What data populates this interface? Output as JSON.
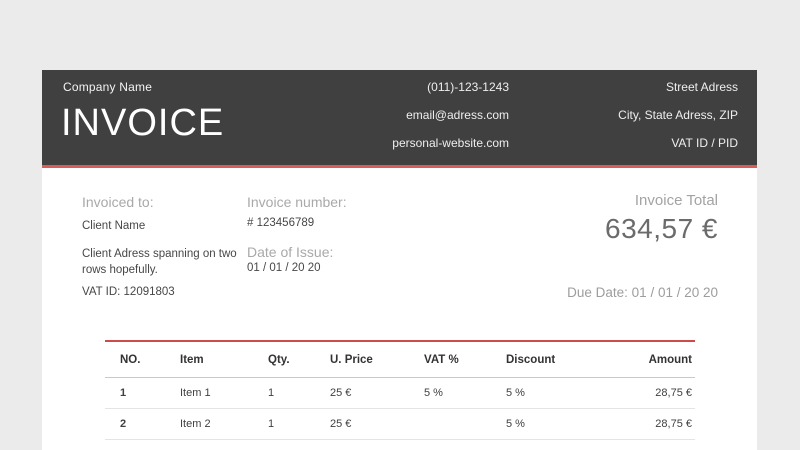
{
  "colors": {
    "canvas_background": "#ebebeb",
    "header_background": "#404040",
    "accent_red_header": "#d95c5c",
    "accent_red_table": "#cc4b4b"
  },
  "header": {
    "company_name": "Company Name",
    "doc_title": "INVOICE",
    "contact": {
      "phone": "(011)-123-1243",
      "email": "email@adress.com",
      "website": "personal-website.com"
    },
    "address": {
      "street": "Street Adress",
      "city": "City, State Adress, ZIP",
      "vat": "VAT ID / PID"
    }
  },
  "billing": {
    "label": "Invoiced to:",
    "client_name": "Client Name",
    "client_address_line1": "Client Adress spanning on two",
    "client_address_line2": "rows hopefully.",
    "vat_id": "VAT ID: 12091803"
  },
  "meta": {
    "invoice_number_label": "Invoice number:",
    "invoice_number": "# 123456789",
    "date_of_issue_label": "Date of Issue:",
    "date_of_issue": "01 / 01 / 20 20"
  },
  "totals": {
    "total_label": "Invoice Total",
    "total_value": "634,57 €",
    "due_date": "Due Date: 01 / 01 / 20 20"
  },
  "table": {
    "columns": [
      "NO.",
      "Item",
      "Qty.",
      "U. Price",
      "VAT %",
      "Discount",
      "Amount"
    ],
    "rows": [
      [
        "1",
        "Item 1",
        "1",
        "25 €",
        "5 %",
        "5 %",
        "28,75 €"
      ],
      [
        "2",
        "Item 2",
        "1",
        "25 €",
        "",
        "5 %",
        "28,75 €"
      ]
    ]
  }
}
